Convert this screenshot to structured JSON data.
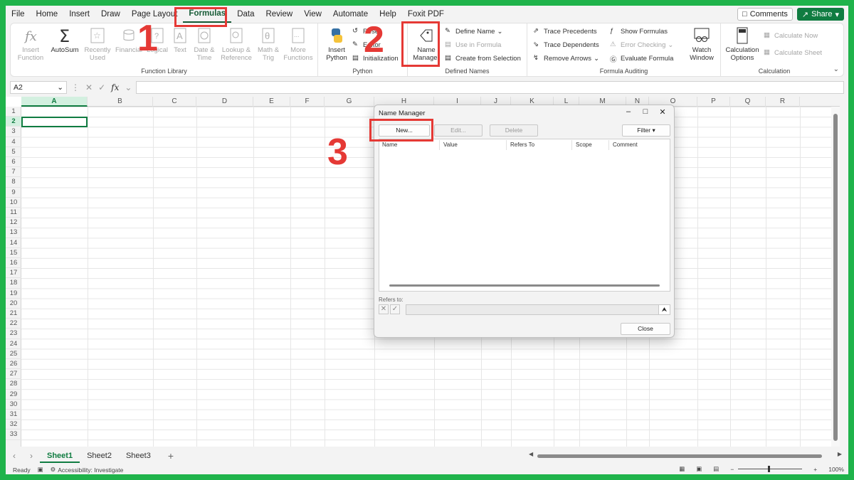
{
  "menu": {
    "items": [
      "File",
      "Home",
      "Insert",
      "Draw",
      "Page Layout",
      "Formulas",
      "Data",
      "Review",
      "View",
      "Automate",
      "Help",
      "Foxit PDF"
    ],
    "active": "Formulas",
    "comments": "Comments",
    "share": "Share"
  },
  "ribbon": {
    "function_library": {
      "label": "Function Library",
      "insert_function": "Insert Function",
      "autosum": "AutoSum",
      "recently_used": "Recently Used",
      "financial": "Financial",
      "logical": "Logical",
      "text": "Text",
      "date_time": "Date & Time",
      "lookup_reference": "Lookup & Reference",
      "math_trig": "Math & Trig",
      "more_functions": "More Functions"
    },
    "python": {
      "label": "Python",
      "insert_python": "Insert Python",
      "reset": "Reset",
      "editor": "Editor",
      "initialization": "Initialization"
    },
    "defined_names": {
      "label": "Defined Names",
      "name_manager": "Name Manager",
      "define_name": "Define Name",
      "use_in_formula": "Use in Formula",
      "create_from_selection": "Create from Selection"
    },
    "formula_auditing": {
      "label": "Formula Auditing",
      "trace_precedents": "Trace Precedents",
      "trace_dependents": "Trace Dependents",
      "remove_arrows": "Remove Arrows",
      "show_formulas": "Show Formulas",
      "error_checking": "Error Checking",
      "evaluate_formula": "Evaluate Formula",
      "watch_window": "Watch Window"
    },
    "calculation": {
      "label": "Calculation",
      "calculation_options": "Calculation Options",
      "calculate_now": "Calculate Now",
      "calculate_sheet": "Calculate Sheet"
    }
  },
  "formula_bar": {
    "name_box": "A2",
    "fx": "fx"
  },
  "grid": {
    "columns": [
      "A",
      "B",
      "C",
      "D",
      "E",
      "F",
      "G",
      "H",
      "I",
      "J",
      "K",
      "L",
      "M",
      "N",
      "O",
      "P",
      "Q",
      "R"
    ],
    "rows": [
      "1",
      "2",
      "3",
      "4",
      "5",
      "6",
      "7",
      "8",
      "9",
      "10",
      "11",
      "12",
      "13",
      "14",
      "15",
      "16",
      "17",
      "18",
      "19",
      "20",
      "21",
      "22",
      "23",
      "24",
      "25",
      "26",
      "27",
      "28",
      "29",
      "30",
      "31",
      "32",
      "33"
    ],
    "selected_col": "A",
    "selected_row": "2"
  },
  "sheets": {
    "tabs": [
      "Sheet1",
      "Sheet2",
      "Sheet3"
    ],
    "active": "Sheet1",
    "add": "+"
  },
  "status": {
    "ready": "Ready",
    "accessibility": "Accessibility: Investigate",
    "zoom": "100%"
  },
  "dialog": {
    "title": "Name Manager",
    "new": "New...",
    "edit": "Edit...",
    "delete": "Delete",
    "filter": "Filter",
    "columns": [
      "Name",
      "Value",
      "Refers To",
      "Scope",
      "Comment"
    ],
    "refers_to": "Refers to:",
    "close": "Close"
  },
  "annotations": {
    "step1": "1",
    "step2": "2",
    "step3": "3",
    "color": "#e53935"
  }
}
